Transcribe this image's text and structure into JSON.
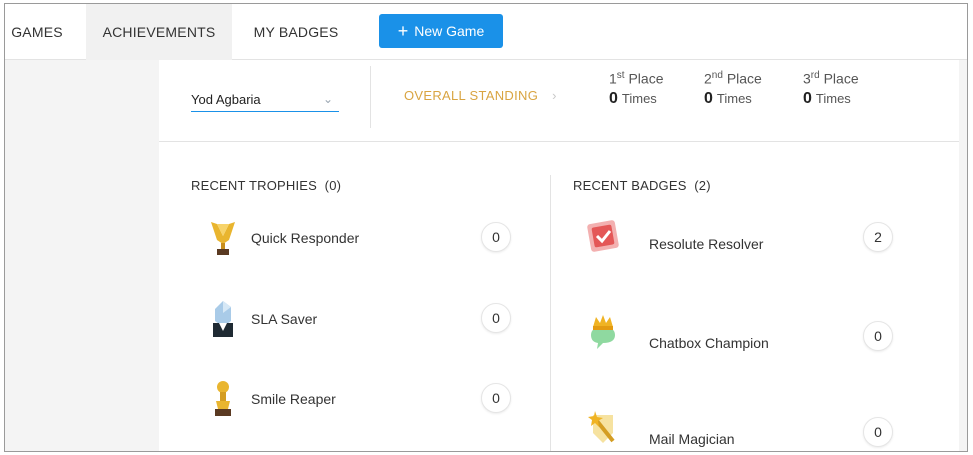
{
  "nav": {
    "tabs": [
      {
        "label": "GAMES",
        "active": false
      },
      {
        "label": "ACHIEVEMENTS",
        "active": true
      },
      {
        "label": "MY BADGES",
        "active": false
      }
    ],
    "new_game_label": "New Game",
    "accent_color": "#1a91e8"
  },
  "standing": {
    "agent_name": "Yod Agbaria",
    "overall_label": "OVERALL STANDING",
    "places": [
      {
        "rank": "1",
        "suffix": "st",
        "label": "Place",
        "count": "0",
        "unit": "Times"
      },
      {
        "rank": "2",
        "suffix": "nd",
        "label": "Place",
        "count": "0",
        "unit": "Times"
      },
      {
        "rank": "3",
        "suffix": "rd",
        "label": "Place",
        "count": "0",
        "unit": "Times"
      }
    ]
  },
  "trophies": {
    "title": "RECENT TROPHIES",
    "count": "(0)",
    "items": [
      {
        "name": "Quick Responder",
        "count": "0",
        "icon": "gold-trophy-icon"
      },
      {
        "name": "SLA Saver",
        "count": "0",
        "icon": "crystal-trophy-icon"
      },
      {
        "name": "Smile Reaper",
        "count": "0",
        "icon": "gold-cup-trophy-icon"
      }
    ]
  },
  "badges": {
    "title": "RECENT BADGES",
    "count": "(2)",
    "items": [
      {
        "name": "Resolute Resolver",
        "count": "2",
        "icon": "red-shield-badge-icon"
      },
      {
        "name": "Chatbox Champion",
        "count": "0",
        "icon": "crown-chat-badge-icon"
      },
      {
        "name": "Mail Magician",
        "count": "0",
        "icon": "magic-wand-badge-icon"
      }
    ]
  }
}
